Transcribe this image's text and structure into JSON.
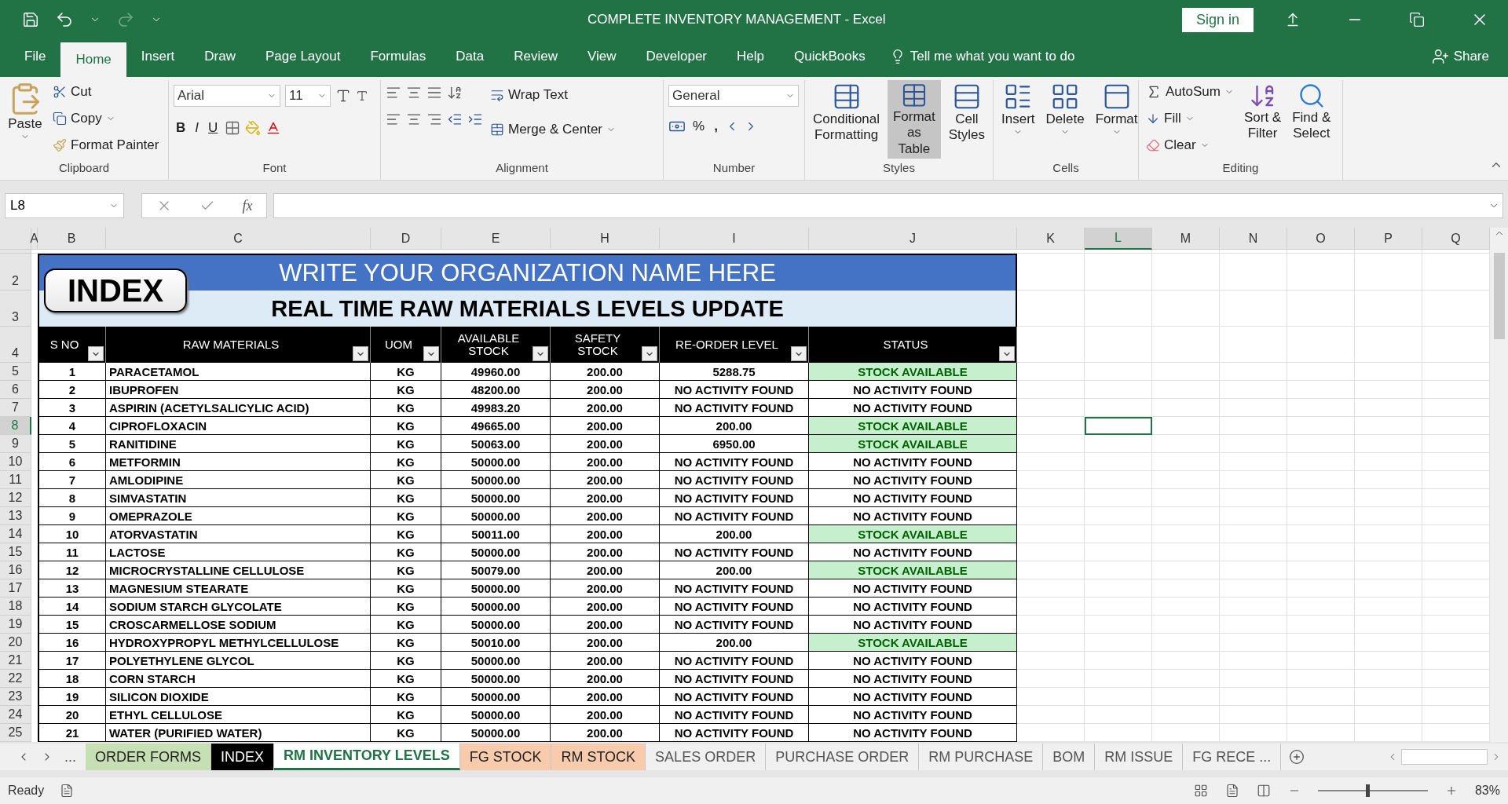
{
  "title_bar": {
    "title": "COMPLETE INVENTORY MANAGEMENT  -  Excel",
    "sign_in": "Sign in"
  },
  "menu_tabs": [
    {
      "label": "File",
      "selected": false
    },
    {
      "label": "Home",
      "selected": true
    },
    {
      "label": "Insert",
      "selected": false
    },
    {
      "label": "Draw",
      "selected": false
    },
    {
      "label": "Page Layout",
      "selected": false
    },
    {
      "label": "Formulas",
      "selected": false
    },
    {
      "label": "Data",
      "selected": false
    },
    {
      "label": "Review",
      "selected": false
    },
    {
      "label": "View",
      "selected": false
    },
    {
      "label": "Developer",
      "selected": false
    },
    {
      "label": "Help",
      "selected": false
    },
    {
      "label": "QuickBooks",
      "selected": false
    }
  ],
  "tell_me": "Tell me what you want to do",
  "share": "Share",
  "ribbon": {
    "clipboard": {
      "paste": "Paste",
      "cut": "Cut",
      "copy": "Copy",
      "format_painter": "Format Painter",
      "label": "Clipboard"
    },
    "font": {
      "font_name": "Arial",
      "font_size": "11",
      "bold": "B",
      "italic": "I",
      "underline": "U",
      "label": "Font"
    },
    "alignment": {
      "wrap_text": "Wrap Text",
      "merge_center": "Merge & Center",
      "label": "Alignment"
    },
    "number": {
      "format": "General",
      "percent": "%",
      "comma": ",",
      "label": "Number"
    },
    "styles": {
      "buttons": [
        {
          "lines": [
            "Conditional",
            "Formatting"
          ],
          "selected": false
        },
        {
          "lines": [
            "Format as",
            "Table"
          ],
          "selected": true
        },
        {
          "lines": [
            "Cell",
            "Styles"
          ],
          "selected": false
        }
      ],
      "label": "Styles"
    },
    "cells": {
      "buttons": [
        "Insert",
        "Delete",
        "Format"
      ],
      "label": "Cells"
    },
    "editing": {
      "autosum": "AutoSum",
      "fill": "Fill",
      "clear": "Clear",
      "sort": [
        "Sort &",
        "Filter"
      ],
      "find": [
        "Find &",
        "Select"
      ],
      "label": "Editing"
    }
  },
  "formula_bar": {
    "name_box": "L8",
    "fx": "fx"
  },
  "columns": [
    {
      "label": "A",
      "selected": false
    },
    {
      "label": "B",
      "selected": false
    },
    {
      "label": "C",
      "selected": false
    },
    {
      "label": "D",
      "selected": false
    },
    {
      "label": "E",
      "selected": false
    },
    {
      "label": "H",
      "selected": false
    },
    {
      "label": "I",
      "selected": false
    },
    {
      "label": "J",
      "selected": false
    },
    {
      "label": "K",
      "selected": false
    },
    {
      "label": "L",
      "selected": true
    },
    {
      "label": "M",
      "selected": false
    },
    {
      "label": "N",
      "selected": false
    },
    {
      "label": "O",
      "selected": false
    },
    {
      "label": "P",
      "selected": false
    },
    {
      "label": "Q",
      "selected": false
    }
  ],
  "row_headers": [
    {
      "label": "2",
      "selected": false
    },
    {
      "label": "3",
      "selected": false
    },
    {
      "label": "4",
      "selected": false
    },
    {
      "label": "5",
      "selected": false
    },
    {
      "label": "6",
      "selected": false
    },
    {
      "label": "7",
      "selected": false
    },
    {
      "label": "8",
      "selected": true
    },
    {
      "label": "9",
      "selected": false
    },
    {
      "label": "10",
      "selected": false
    },
    {
      "label": "11",
      "selected": false
    },
    {
      "label": "12",
      "selected": false
    },
    {
      "label": "13",
      "selected": false
    },
    {
      "label": "14",
      "selected": false
    },
    {
      "label": "15",
      "selected": false
    },
    {
      "label": "16",
      "selected": false
    },
    {
      "label": "17",
      "selected": false
    },
    {
      "label": "18",
      "selected": false
    },
    {
      "label": "19",
      "selected": false
    },
    {
      "label": "20",
      "selected": false
    },
    {
      "label": "21",
      "selected": false
    },
    {
      "label": "22",
      "selected": false
    },
    {
      "label": "23",
      "selected": false
    },
    {
      "label": "24",
      "selected": false
    },
    {
      "label": "25",
      "selected": false
    }
  ],
  "sheet": {
    "index_button": "INDEX",
    "organization": "WRITE YOUR ORGANIZATION NAME HERE",
    "subtitle": "REAL TIME RAW MATERIALS LEVELS UPDATE",
    "headers": [
      "S NO",
      "RAW MATERIALS",
      "UOM",
      [
        "AVAILABLE",
        "STOCK"
      ],
      "SAFETY STOCK",
      "RE-ORDER LEVEL",
      "STATUS"
    ],
    "rows": [
      {
        "no": "1",
        "material": "PARACETAMOL",
        "uom": "KG",
        "available": "49960.00",
        "safety": "200.00",
        "reorder": "5288.75",
        "status": "STOCK AVAILABLE",
        "in_stock": true
      },
      {
        "no": "2",
        "material": "IBUPROFEN",
        "uom": "KG",
        "available": "48200.00",
        "safety": "200.00",
        "reorder": "NO ACTIVITY FOUND",
        "status": "NO ACTIVITY FOUND",
        "in_stock": false
      },
      {
        "no": "3",
        "material": "ASPIRIN (ACETYLSALICYLIC ACID)",
        "uom": "KG",
        "available": "49983.20",
        "safety": "200.00",
        "reorder": "NO ACTIVITY FOUND",
        "status": "NO ACTIVITY FOUND",
        "in_stock": false
      },
      {
        "no": "4",
        "material": "CIPROFLOXACIN",
        "uom": "KG",
        "available": "49665.00",
        "safety": "200.00",
        "reorder": "200.00",
        "status": "STOCK AVAILABLE",
        "in_stock": true
      },
      {
        "no": "5",
        "material": "RANITIDINE",
        "uom": "KG",
        "available": "50063.00",
        "safety": "200.00",
        "reorder": "6950.00",
        "status": "STOCK AVAILABLE",
        "in_stock": true
      },
      {
        "no": "6",
        "material": "METFORMIN",
        "uom": "KG",
        "available": "50000.00",
        "safety": "200.00",
        "reorder": "NO ACTIVITY FOUND",
        "status": "NO ACTIVITY FOUND",
        "in_stock": false
      },
      {
        "no": "7",
        "material": "AMLODIPINE",
        "uom": "KG",
        "available": "50000.00",
        "safety": "200.00",
        "reorder": "NO ACTIVITY FOUND",
        "status": "NO ACTIVITY FOUND",
        "in_stock": false
      },
      {
        "no": "8",
        "material": "SIMVASTATIN",
        "uom": "KG",
        "available": "50000.00",
        "safety": "200.00",
        "reorder": "NO ACTIVITY FOUND",
        "status": "NO ACTIVITY FOUND",
        "in_stock": false
      },
      {
        "no": "9",
        "material": "OMEPRAZOLE",
        "uom": "KG",
        "available": "50000.00",
        "safety": "200.00",
        "reorder": "NO ACTIVITY FOUND",
        "status": "NO ACTIVITY FOUND",
        "in_stock": false
      },
      {
        "no": "10",
        "material": "ATORVASTATIN",
        "uom": "KG",
        "available": "50011.00",
        "safety": "200.00",
        "reorder": "200.00",
        "status": "STOCK AVAILABLE",
        "in_stock": true
      },
      {
        "no": "11",
        "material": "LACTOSE",
        "uom": "KG",
        "available": "50000.00",
        "safety": "200.00",
        "reorder": "NO ACTIVITY FOUND",
        "status": "NO ACTIVITY FOUND",
        "in_stock": false
      },
      {
        "no": "12",
        "material": "MICROCRYSTALLINE CELLULOSE",
        "uom": "KG",
        "available": "50079.00",
        "safety": "200.00",
        "reorder": "200.00",
        "status": "STOCK AVAILABLE",
        "in_stock": true
      },
      {
        "no": "13",
        "material": "MAGNESIUM STEARATE",
        "uom": "KG",
        "available": "50000.00",
        "safety": "200.00",
        "reorder": "NO ACTIVITY FOUND",
        "status": "NO ACTIVITY FOUND",
        "in_stock": false
      },
      {
        "no": "14",
        "material": "SODIUM STARCH GLYCOLATE",
        "uom": "KG",
        "available": "50000.00",
        "safety": "200.00",
        "reorder": "NO ACTIVITY FOUND",
        "status": "NO ACTIVITY FOUND",
        "in_stock": false
      },
      {
        "no": "15",
        "material": "CROSCARMELLOSE SODIUM",
        "uom": "KG",
        "available": "50000.00",
        "safety": "200.00",
        "reorder": "NO ACTIVITY FOUND",
        "status": "NO ACTIVITY FOUND",
        "in_stock": false
      },
      {
        "no": "16",
        "material": "HYDROXYPROPYL METHYLCELLULOSE",
        "uom": "KG",
        "available": "50010.00",
        "safety": "200.00",
        "reorder": "200.00",
        "status": "STOCK AVAILABLE",
        "in_stock": true
      },
      {
        "no": "17",
        "material": "POLYETHYLENE GLYCOL",
        "uom": "KG",
        "available": "50000.00",
        "safety": "200.00",
        "reorder": "NO ACTIVITY FOUND",
        "status": "NO ACTIVITY FOUND",
        "in_stock": false
      },
      {
        "no": "18",
        "material": "CORN STARCH",
        "uom": "KG",
        "available": "50000.00",
        "safety": "200.00",
        "reorder": "NO ACTIVITY FOUND",
        "status": "NO ACTIVITY FOUND",
        "in_stock": false
      },
      {
        "no": "19",
        "material": "SILICON DIOXIDE",
        "uom": "KG",
        "available": "50000.00",
        "safety": "200.00",
        "reorder": "NO ACTIVITY FOUND",
        "status": "NO ACTIVITY FOUND",
        "in_stock": false
      },
      {
        "no": "20",
        "material": "ETHYL CELLULOSE",
        "uom": "KG",
        "available": "50000.00",
        "safety": "200.00",
        "reorder": "NO ACTIVITY FOUND",
        "status": "NO ACTIVITY FOUND",
        "in_stock": false
      },
      {
        "no": "21",
        "material": "WATER (PURIFIED WATER)",
        "uom": "KG",
        "available": "50000.00",
        "safety": "200.00",
        "reorder": "NO ACTIVITY FOUND",
        "status": "NO ACTIVITY FOUND",
        "in_stock": false
      }
    ]
  },
  "sheet_nav": "...",
  "sheet_tabs": [
    {
      "label": "ORDER FORMS",
      "selected": false,
      "color": "#c6e0b4"
    },
    {
      "label": "INDEX",
      "selected": false,
      "color": "#000000"
    },
    {
      "label": "RM INVENTORY LEVELS",
      "selected": true
    },
    {
      "label": "FG STOCK",
      "selected": false,
      "color": "#f8cbad"
    },
    {
      "label": "RM STOCK",
      "selected": false,
      "color": "#f8cbad"
    },
    {
      "label": "SALES ORDER",
      "selected": false
    },
    {
      "label": "PURCHASE ORDER",
      "selected": false
    },
    {
      "label": "RM PURCHASE",
      "selected": false
    },
    {
      "label": "BOM",
      "selected": false
    },
    {
      "label": "RM ISSUE",
      "selected": false
    },
    {
      "label": "FG RECE ...",
      "selected": false
    }
  ],
  "status_bar": {
    "ready": "Ready",
    "zoom": "83%",
    "zoom_level": {
      "level": 0.45
    }
  }
}
